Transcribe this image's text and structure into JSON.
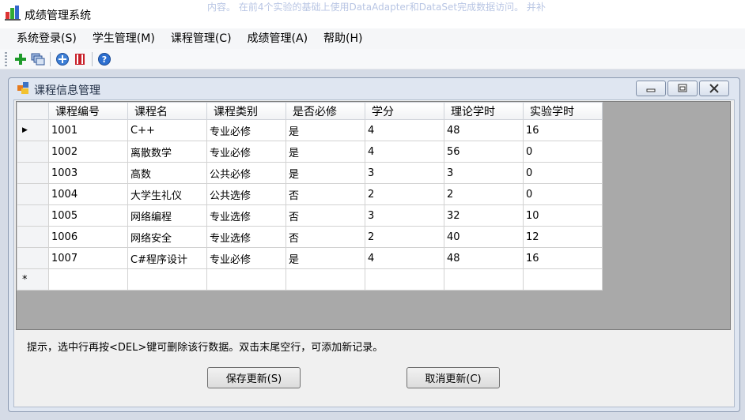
{
  "window": {
    "title": "成绩管理系统",
    "background_text": "内容。  在前4个实验的基础上使用DataAdapter和DataSet完成数据访问。 并补"
  },
  "menu": {
    "items": [
      {
        "label": "系统登录(S)"
      },
      {
        "label": "学生管理(M)"
      },
      {
        "label": "课程管理(C)"
      },
      {
        "label": "成绩管理(A)"
      },
      {
        "label": "帮助(H)"
      }
    ]
  },
  "toolbar": {
    "icons": [
      "add-icon",
      "cascade-windows-icon",
      "zoom-plus-icon",
      "book-icon",
      "help-icon"
    ]
  },
  "child_window": {
    "title": "课程信息管理",
    "controls": [
      "minimize-icon",
      "restore-icon",
      "close-icon"
    ]
  },
  "grid": {
    "columns": [
      "课程编号",
      "课程名",
      "课程类别",
      "是否必修",
      "学分",
      "理论学时",
      "实验学时"
    ],
    "rows": [
      [
        "1001",
        "C++",
        "专业必修",
        "是",
        "4",
        "48",
        "16"
      ],
      [
        "1002",
        "离散数学",
        "专业必修",
        "是",
        "4",
        "56",
        "0"
      ],
      [
        "1003",
        "高数",
        "公共必修",
        "是",
        "3",
        "3",
        "0"
      ],
      [
        "1004",
        "大学生礼仪",
        "公共选修",
        "否",
        "2",
        "2",
        "0"
      ],
      [
        "1005",
        "网络编程",
        "专业选修",
        "否",
        "3",
        "32",
        "10"
      ],
      [
        "1006",
        "网络安全",
        "专业选修",
        "否",
        "2",
        "40",
        "12"
      ],
      [
        "1007",
        "C#程序设计",
        "专业必修",
        "是",
        "4",
        "48",
        "16"
      ]
    ],
    "current_row_marker": "▶",
    "new_row_marker": "*"
  },
  "hint": "提示，选中行再按<DEL>键可删除该行数据。双击末尾空行，可添加新记录。",
  "buttons": {
    "save": "保存更新(S)",
    "cancel": "取消更新(C)"
  },
  "colors": {
    "mdi_background": "#d5dbe6",
    "grid_background": "#a9a9a9",
    "child_frame": "#dfe6f1"
  }
}
